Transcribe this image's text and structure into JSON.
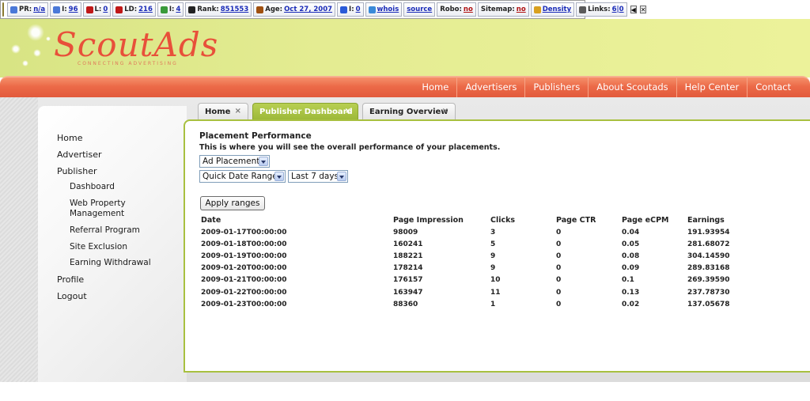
{
  "toolbar": {
    "items": [
      {
        "label": "PR:",
        "value": "n/a",
        "icon": "google-icon"
      },
      {
        "label": "I:",
        "value": "96",
        "icon": "google-icon"
      },
      {
        "label": "L:",
        "value": "0",
        "icon": "yahoo-icon"
      },
      {
        "label": "LD:",
        "value": "216",
        "icon": "yahoo-icon"
      },
      {
        "label": "I:",
        "value": "4",
        "icon": "msn-icon"
      },
      {
        "label": "Rank:",
        "value": "851553",
        "icon": "alexa-icon"
      },
      {
        "label": "Age:",
        "value": "Oct 27, 2007",
        "icon": "archive-icon"
      },
      {
        "label": "I:",
        "value": "0",
        "icon": "delicious-icon"
      },
      {
        "label": "",
        "value": "whois",
        "icon": "whois-icon"
      },
      {
        "label": "",
        "value": "source",
        "icon": ""
      },
      {
        "label": "Robo:",
        "value": "no",
        "icon": ""
      },
      {
        "label": "Sitemap:",
        "value": "no",
        "icon": ""
      },
      {
        "label": "",
        "value": "Density",
        "icon": "density-icon"
      },
      {
        "label": "Links:",
        "value": "6|0",
        "icon": "links-icon"
      }
    ],
    "prev": "◀",
    "close": "✕"
  },
  "brand": {
    "logo": "ScoutAds",
    "tagline": "CONNECTING ADVERTISING"
  },
  "nav": [
    "Home",
    "Advertisers",
    "Publishers",
    "About Scoutads",
    "Help Center",
    "Contact"
  ],
  "sidebar": {
    "items": [
      {
        "label": "Home",
        "sub": false
      },
      {
        "label": "Advertiser",
        "sub": false
      },
      {
        "label": "Publisher",
        "sub": false
      },
      {
        "label": "Dashboard",
        "sub": true
      },
      {
        "label": "Web Property Management",
        "sub": true
      },
      {
        "label": "Referral Program",
        "sub": true
      },
      {
        "label": "Site Exclusion",
        "sub": true
      },
      {
        "label": "Earning Withdrawal",
        "sub": true
      },
      {
        "label": "Profile",
        "sub": false
      },
      {
        "label": "Logout",
        "sub": false
      }
    ]
  },
  "tabs": [
    {
      "label": "Home",
      "active": false
    },
    {
      "label": "Publisher Dashboard",
      "active": true
    },
    {
      "label": "Earning Overview",
      "active": false
    }
  ],
  "tab_close": "×",
  "main": {
    "title": "Placement Performance",
    "description": "This is where you will see the overall performance of your placements.",
    "placement_select": "Ad Placement",
    "range_select": "Quick Date Range",
    "period_select": "Last 7 days",
    "apply_label": "Apply ranges"
  },
  "table": {
    "headers": [
      "Date",
      "Page Impression",
      "Clicks",
      "Page CTR",
      "Page eCPM",
      "Earnings"
    ],
    "rows": [
      [
        "2009-01-17T00:00:00",
        "98009",
        "3",
        "0",
        "0.04",
        "191.93954"
      ],
      [
        "2009-01-18T00:00:00",
        "160241",
        "5",
        "0",
        "0.05",
        "281.68072"
      ],
      [
        "2009-01-19T00:00:00",
        "188221",
        "9",
        "0",
        "0.08",
        "304.14590"
      ],
      [
        "2009-01-20T00:00:00",
        "178214",
        "9",
        "0",
        "0.09",
        "289.83168"
      ],
      [
        "2009-01-21T00:00:00",
        "176157",
        "10",
        "0",
        "0.1",
        "269.39590"
      ],
      [
        "2009-01-22T00:00:00",
        "163947",
        "11",
        "0",
        "0.13",
        "237.78730"
      ],
      [
        "2009-01-23T00:00:00",
        "88360",
        "1",
        "0",
        "0.02",
        "137.05678"
      ]
    ]
  },
  "colors": {
    "accent_green": "#a8c040",
    "nav_orange": "#e8603f",
    "logo_red": "#e8503a"
  }
}
